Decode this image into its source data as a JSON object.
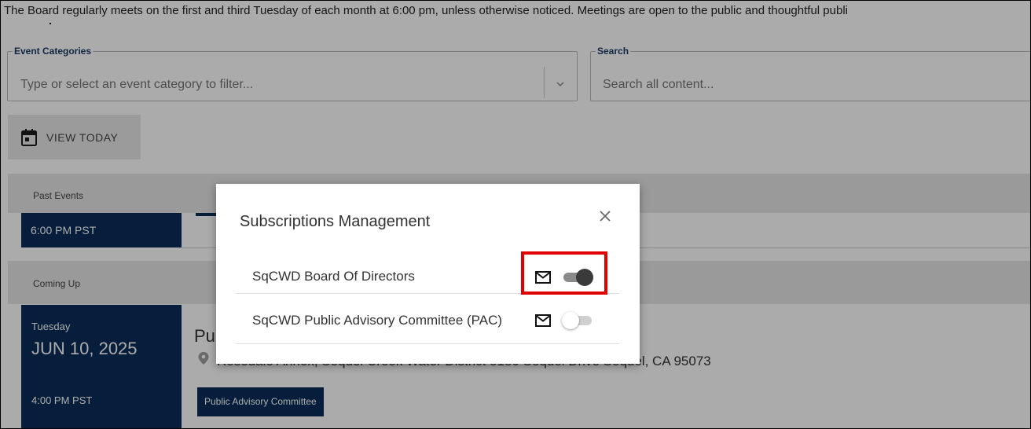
{
  "intro_text": "The Board regularly meets on the first and third Tuesday of each month at 6:00 pm, unless otherwise noticed. Meetings are open to the public and thoughtful publi",
  "filters": {
    "category_legend": "Event Categories",
    "category_placeholder": "Type or select an event category to filter...",
    "search_legend": "Search",
    "search_placeholder": "Search all content..."
  },
  "view_today_label": "VIEW TODAY",
  "past_events": {
    "label": "Past Events",
    "card_time": "6:00 PM PST"
  },
  "coming_up": {
    "label": "Coming Up",
    "card": {
      "day": "Tuesday",
      "date": "JUN 10, 2025",
      "time": "4:00 PM PST"
    },
    "event_title": "Pu",
    "event_address": "Rosedale Annex, Soquel Creek Water District 5180 Soquel Drive Soquel, CA 95073",
    "event_badge": "Public Advisory Committee"
  },
  "modal": {
    "title": "Subscriptions Management",
    "subscriptions": [
      {
        "name": "SqCWD Board Of Directors",
        "subscribed": true
      },
      {
        "name": "SqCWD Public Advisory Committee (PAC)",
        "subscribed": false
      }
    ]
  },
  "colors": {
    "navy": "#0a2e58",
    "highlight": "#e00000"
  }
}
